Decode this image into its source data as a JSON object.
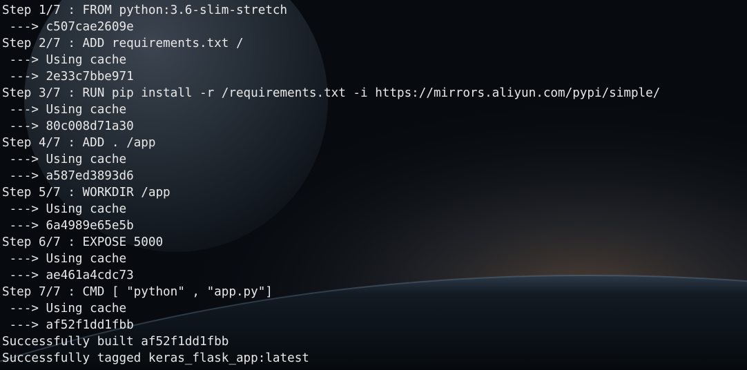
{
  "terminal": {
    "lines": [
      "Step 1/7 : FROM python:3.6-slim-stretch",
      " ---> c507cae2609e",
      "Step 2/7 : ADD requirements.txt /",
      " ---> Using cache",
      " ---> 2e33c7bbe971",
      "Step 3/7 : RUN pip install -r /requirements.txt -i https://mirrors.aliyun.com/pypi/simple/",
      " ---> Using cache",
      " ---> 80c008d71a30",
      "Step 4/7 : ADD . /app",
      " ---> Using cache",
      " ---> a587ed3893d6",
      "Step 5/7 : WORKDIR /app",
      " ---> Using cache",
      " ---> 6a4989e65e5b",
      "Step 6/7 : EXPOSE 5000",
      " ---> Using cache",
      " ---> ae461a4cdc73",
      "Step 7/7 : CMD [ \"python\" , \"app.py\"]",
      " ---> Using cache",
      " ---> af52f1dd1fbb",
      "Successfully built af52f1dd1fbb",
      "Successfully tagged keras_flask_app:latest"
    ]
  },
  "colors": {
    "background": "#070b10",
    "text": "#e8e8e8"
  }
}
